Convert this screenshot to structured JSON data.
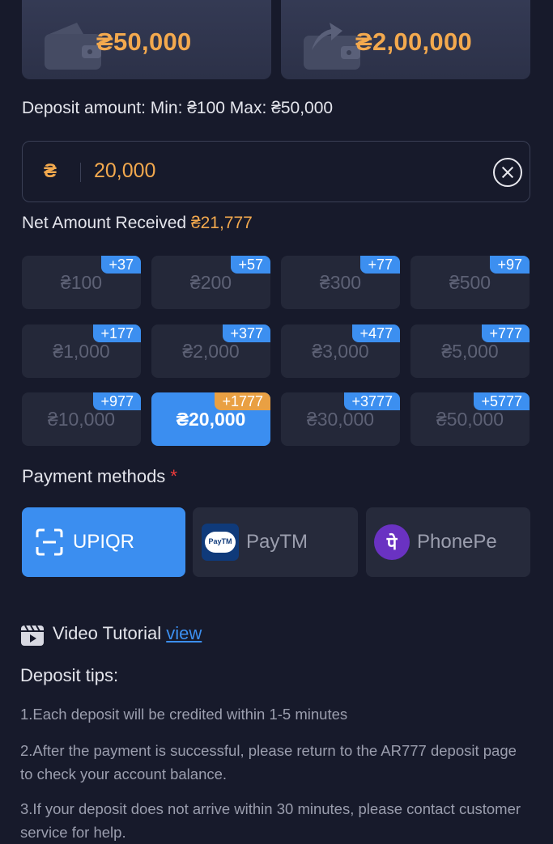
{
  "wallets": [
    {
      "icon": "wallet-icon",
      "amount": "₴50,000"
    },
    {
      "icon": "wallet-arrow-icon",
      "amount": "₴2,00,000"
    }
  ],
  "deposit_range_label": "Deposit amount: Min: ₴100 Max: ₴50,000",
  "amount_input": {
    "currency": "₴",
    "value": "20,000"
  },
  "net_amount": {
    "label": "Net Amount Received",
    "value": "₴21,777"
  },
  "amount_options": [
    {
      "value": "₴100",
      "bonus": "+37",
      "selected": false
    },
    {
      "value": "₴200",
      "bonus": "+57",
      "selected": false
    },
    {
      "value": "₴300",
      "bonus": "+77",
      "selected": false
    },
    {
      "value": "₴500",
      "bonus": "+97",
      "selected": false
    },
    {
      "value": "₴1,000",
      "bonus": "+177",
      "selected": false
    },
    {
      "value": "₴2,000",
      "bonus": "+377",
      "selected": false
    },
    {
      "value": "₴3,000",
      "bonus": "+477",
      "selected": false
    },
    {
      "value": "₴5,000",
      "bonus": "+777",
      "selected": false
    },
    {
      "value": "₴10,000",
      "bonus": "+977",
      "selected": false
    },
    {
      "value": "₴20,000",
      "bonus": "+1777",
      "selected": true
    },
    {
      "value": "₴30,000",
      "bonus": "+3777",
      "selected": false
    },
    {
      "value": "₴50,000",
      "bonus": "+5777",
      "selected": false
    }
  ],
  "payment_methods_title": "Payment methods",
  "required_mark": "*",
  "payment_methods": [
    {
      "name": "UPIQR",
      "icon": "scan-icon",
      "selected": true
    },
    {
      "name": "PayTM",
      "icon": "paytm-logo-icon",
      "selected": false
    },
    {
      "name": "PhonePe",
      "icon": "phonepe-logo-icon",
      "selected": false
    }
  ],
  "paytm_logo_text": "PayTM",
  "phonepe_logo_text": "पे",
  "video_tutorial": {
    "label": "Video Tutorial",
    "link": "view"
  },
  "tips_title": "Deposit tips:",
  "tips": [
    "1.Each deposit will be credited within 1-5 minutes",
    "2.After the payment is successful, please return to the AR777 deposit page to check your account balance.",
    "3.If your deposit does not arrive within 30 minutes, please contact customer service for help."
  ],
  "colors": {
    "accent_orange": "#f3a94e",
    "accent_blue": "#3b8ef0",
    "background": "#171a2b"
  }
}
